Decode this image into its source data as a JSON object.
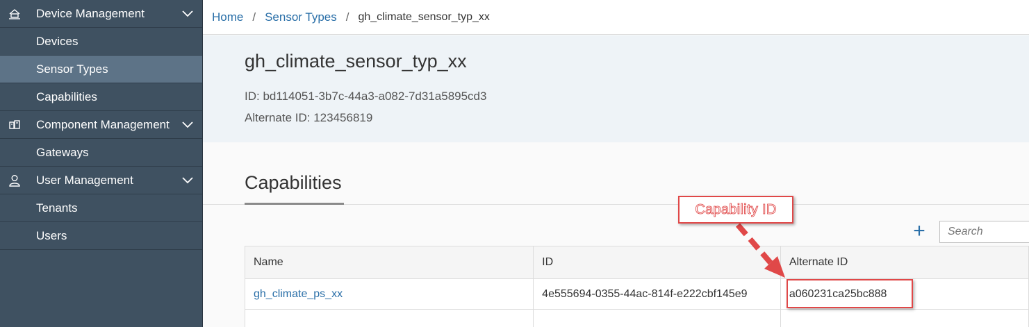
{
  "sidebar": {
    "groups": [
      {
        "label": "Device Management",
        "icon": "device-management-icon",
        "items": [
          "Devices",
          "Sensor Types",
          "Capabilities"
        ]
      },
      {
        "label": "Component Management",
        "icon": "component-management-icon",
        "items": [
          "Gateways"
        ]
      },
      {
        "label": "User Management",
        "icon": "user-icon",
        "items": [
          "Tenants",
          "Users"
        ]
      }
    ],
    "active_item": "Sensor Types"
  },
  "breadcrumb": {
    "home": "Home",
    "sensor_types": "Sensor Types",
    "current": "gh_climate_sensor_typ_xx",
    "separator": "/"
  },
  "header": {
    "title": "gh_climate_sensor_typ_xx",
    "id_line": "ID: bd114051-3b7c-44a3-a082-7d31a5895cd3",
    "alt_id_line": "Alternate ID: 123456819"
  },
  "capabilities": {
    "section_title": "Capabilities",
    "add_label": "+",
    "search_placeholder": "Search",
    "columns": [
      "Name",
      "ID",
      "Alternate ID"
    ],
    "rows": [
      {
        "name": "gh_climate_ps_xx",
        "id": "4e555694-0355-44ac-814f-e222cbf145e9",
        "alternate_id": "a060231ca25bc888"
      }
    ]
  },
  "annotation": {
    "label": "Capability ID",
    "color": "#e04848"
  },
  "colors": {
    "sidebar_bg": "#3f5161",
    "sidebar_active": "#5d7387",
    "link": "#2a6fa8",
    "header_bg": "#eef3f7"
  }
}
